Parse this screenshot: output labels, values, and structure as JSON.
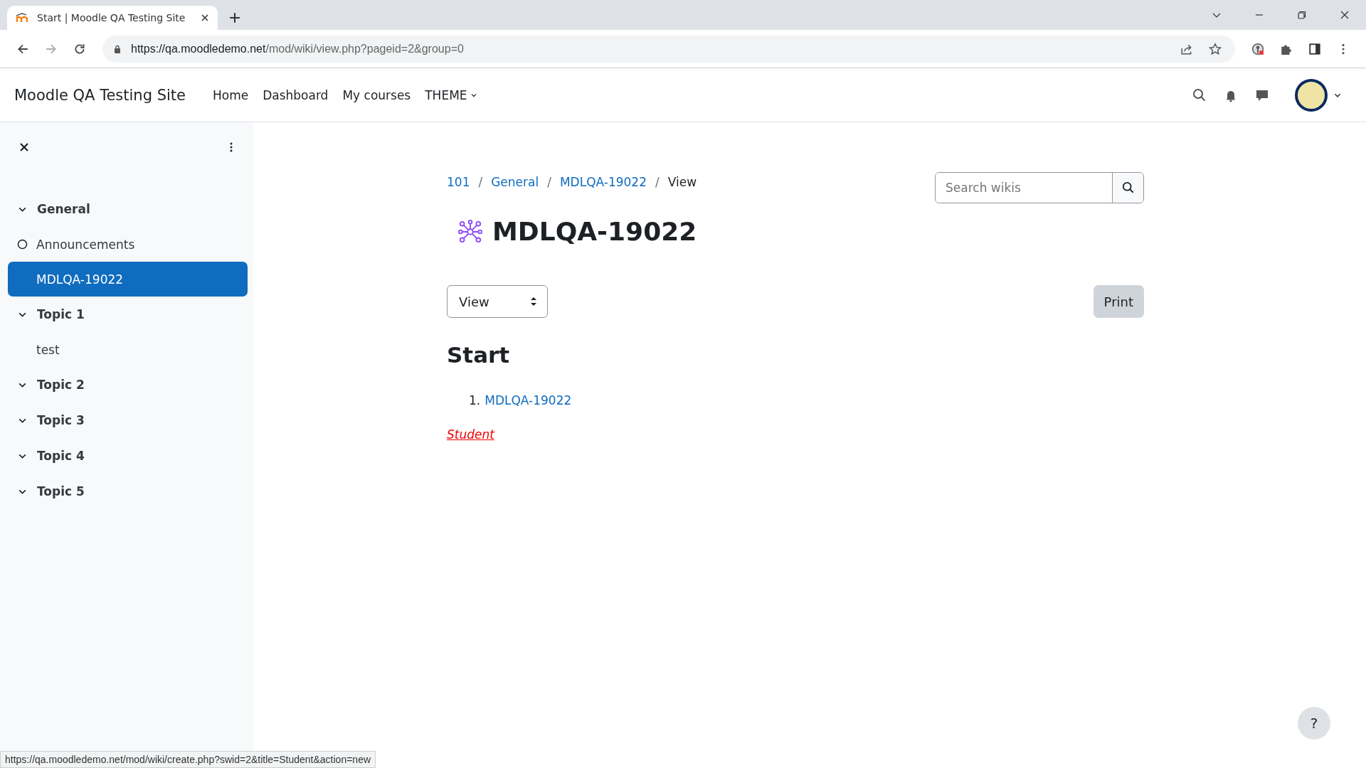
{
  "browser": {
    "tabs": [
      {
        "title": "Start | Moodle QA Testing Site",
        "selected": true
      }
    ],
    "url": {
      "host": "https://qa.moodledemo.net",
      "path": "/mod/wiki/view.php?pageid=2&group=0"
    },
    "status_url": "https://qa.moodledemo.net/mod/wiki/create.php?swid=2&title=Student&action=new"
  },
  "navbar": {
    "site_name": "Moodle QA Testing Site",
    "links": [
      {
        "label": "Home",
        "kind": "link"
      },
      {
        "label": "Dashboard",
        "kind": "link"
      },
      {
        "label": "My courses",
        "kind": "link"
      },
      {
        "label": "THEME",
        "kind": "dropdown"
      }
    ]
  },
  "sidebar": {
    "sections": [
      {
        "title": "General",
        "expanded": true,
        "children": [
          {
            "label": "Announcements",
            "selected": false,
            "completion": true
          },
          {
            "label": "MDLQA-19022",
            "selected": true,
            "completion": false
          }
        ]
      },
      {
        "title": "Topic 1",
        "expanded": true,
        "children": [
          {
            "label": "test",
            "selected": false,
            "completion": false
          }
        ]
      },
      {
        "title": "Topic 2",
        "expanded": true
      },
      {
        "title": "Topic 3",
        "expanded": true
      },
      {
        "title": "Topic 4",
        "expanded": true
      },
      {
        "title": "Topic 5",
        "expanded": true
      }
    ]
  },
  "breadcrumb": [
    {
      "label": "101",
      "link": true
    },
    {
      "separator": "/",
      "label": "General",
      "link": true
    },
    {
      "separator": "/",
      "label": "MDLQA-19022",
      "link": true
    },
    {
      "separator": "/",
      "label": "View",
      "link": false
    }
  ],
  "search": {
    "placeholder": "Search wikis"
  },
  "page_title": "MDLQA-19022",
  "view_select": {
    "value": "View"
  },
  "print_button": "Print",
  "wiki": {
    "heading": "Start",
    "list": [
      {
        "number": "1.",
        "label": "MDLQA-19022"
      }
    ],
    "new_page_link": "Student"
  },
  "help_button": "?"
}
